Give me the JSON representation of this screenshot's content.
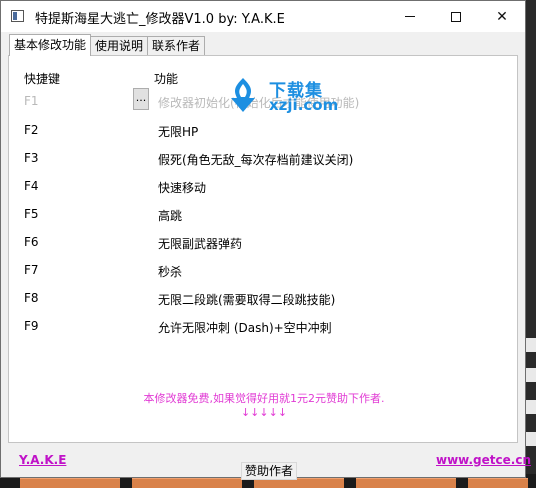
{
  "window": {
    "title": "特提斯海星大逃亡_修改器V1.0 by: Y.A.K.E",
    "minimize": "minimize",
    "maximize": "maximize",
    "close": "✕"
  },
  "tabs": [
    {
      "label": "基本修改功能",
      "active": true
    },
    {
      "label": "使用说明",
      "active": false
    },
    {
      "label": "联系作者",
      "active": false
    }
  ],
  "table": {
    "headers": {
      "key": "快捷键",
      "function": "功能"
    },
    "rows": [
      {
        "key": "F1",
        "function": "修改器初始化(初始化后才能使用功能)",
        "disabled": true
      },
      {
        "key": "F2",
        "function": "无限HP",
        "disabled": false
      },
      {
        "key": "F3",
        "function": "假死(角色无敌_每次存档前建议关闭)",
        "disabled": false
      },
      {
        "key": "F4",
        "function": "快速移动",
        "disabled": false
      },
      {
        "key": "F5",
        "function": "高跳",
        "disabled": false
      },
      {
        "key": "F6",
        "function": "无限副武器弹药",
        "disabled": false
      },
      {
        "key": "F7",
        "function": "秒杀",
        "disabled": false
      },
      {
        "key": "F8",
        "function": "无限二段跳(需要取得二段跳技能)",
        "disabled": false
      },
      {
        "key": "F9",
        "function": "允许无限冲刺 (Dash)+空中冲刺",
        "disabled": false
      }
    ],
    "browse_button": "..."
  },
  "watermark": {
    "name": "下载集",
    "url": "xzji.com"
  },
  "notice": {
    "line1": "本修改器免费,如果觉得好用就1元2元赞助下作者.",
    "line2": "↓↓↓↓↓"
  },
  "footer": {
    "author": "Y.A.K.E",
    "website": "www.getce.cn",
    "sponsor_button": "赞助作者"
  },
  "colors": {
    "accent_pink": "#e13ad4",
    "link_purple": "#c012c8",
    "watermark_blue": "#1d8fe1",
    "disabled_text": "#b9b9b9"
  }
}
